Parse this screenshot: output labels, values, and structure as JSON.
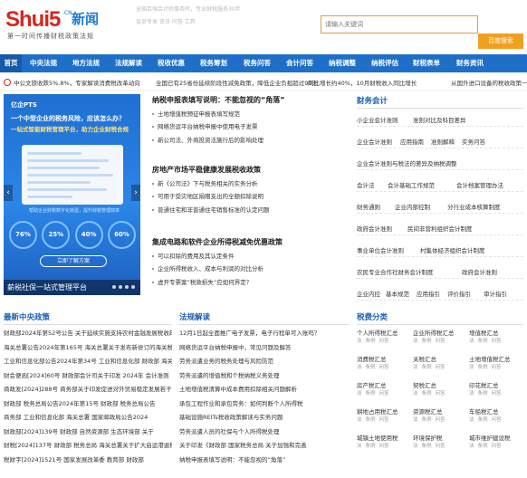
{
  "header": {
    "logo_text": "Shui5",
    "logo_badge": "新闻",
    "logo_dotcn": ".CN",
    "slogan": "第一时间传播财税政策法规",
    "top_ad_lines": [
      "全国百强会计师事务所，专业财税服务30年",
      "会员专享  资讯·问答·工具"
    ],
    "search_placeholder": "请输入关键词",
    "search_button": "百度搜索"
  },
  "nav": {
    "items": [
      "首页",
      "中央法规",
      "地方法规",
      "法规解读",
      "税收优惠",
      "税务筹划",
      "税务问答",
      "会计问答",
      "纳税调整",
      "纳税评估",
      "财税表单",
      "财务资讯"
    ]
  },
  "ticker": {
    "items": [
      "中公文旅收跌5%.8%，专家解读消费税改革动向",
      "全国已有25省份延续阶段性减免政策，降低企业负担超过90天",
      "同比增长约40%，10月财税收入同比增长",
      "从国外进口设备的税收政策一览"
    ]
  },
  "banner": {
    "brand": "亿企PTS",
    "headline": "一个中型企业的税务风险，应该怎么办？",
    "subline": "一站式智能财税管理平台，助力企业财税合规",
    "subtext": "帮助企业财税数字化转型，提升财税管理效率",
    "stats": [
      "76%",
      "25%",
      "40%",
      "60%"
    ],
    "button": "立即了解方案",
    "caption": "薪税社保一站式管理平台"
  },
  "news_blocks": [
    {
      "title": "纳税申报表填写说明：不能忽视的“角落”",
      "items": [
        "土地增值税预征申报表填写规范",
        "网络货运平台纳税申报中使用电子发票",
        "新公司法、外商投资法施行后的影响处理"
      ]
    },
    {
      "title": "房地产市场平稳健康发展税收政策",
      "items": [
        "新《公司法》下与税务相关的实务分析",
        "可用于受灾地区捐赠支出的全额扣除说明",
        "普通住宅和非普通住宅销售标准的认定问题"
      ]
    },
    {
      "title": "集成电路和软件企业所得税减免优惠政策",
      "items": [
        "可以扣除的费用及其认定条件",
        "企业所得税收入、成本与利润的对比分析",
        "虚开专票案“税款损失”应如何界定？"
      ]
    }
  ],
  "finance": {
    "title": "财务会计",
    "rows": [
      [
        "小企业会计准则",
        "准则对比及科目差异"
      ],
      [
        "企业会计准则",
        "应用指南",
        "准则解释",
        "实务问答"
      ],
      [
        "企业会计准则与税法的差异及纳税调整"
      ],
      [
        "会计法",
        "会计基础工作规范",
        "会计档案管理办法"
      ],
      [
        "财务通则",
        "企业内部控制",
        "分行业成本核算制度"
      ],
      [
        "政府会计准则",
        "民间非营利组织会计制度"
      ],
      [
        "事业单位会计准则",
        "村集体经济组织会计制度"
      ],
      [
        "农民专业合作社财务会计制度",
        "政府会计准则"
      ],
      [
        "企业内控",
        "基本规范",
        "应用指引",
        "评价指引",
        "审计指引"
      ]
    ]
  },
  "latest_policy": {
    "title": "最新中央政策",
    "items": [
      "财政部2024年第52号公告 关于延续实施支持农村金融发展税收政策",
      "海关总署公告2024年第165号 海关总署关于发布新修订的海关税则",
      "工业和信息化部公告2024年第34号 工业和信息化部 财政部 海关总署",
      "财会便函[2024]60号 财政部会计司关于印发 2024年 会计准则",
      "商政发[2024]288号 商务部关于印发促进对外贸易稳定发展若干",
      "财政部 税务总局公告2024年第15号 财政部 税务总局公告",
      "商务部 工业和信息化部 海关总署 国家邮政局公告2024",
      "财政部[2024]139号 财政部 自然资源部 生态环境部 关于",
      "财税[2024]137号 财政部 税务总局 海关总署关于扩大启运港退税",
      "税财字[2024]1521号 国家发展改革委 教育部 财政部"
    ]
  },
  "interpretation": {
    "title": "法规解读",
    "items": [
      "12月1日起全面推广电子发票，电子行程单可入账吗？",
      "网络货运平台纳税申报中，常见问题及解答",
      "劳务派遣业务的税务处理与风险防范",
      "劳务派遣的增值税和个税纳税义务处理",
      "土地增值税清算中成本费用扣除相关问题解析",
      "承包工程作业和承包劳务：如何判断个人所得税",
      "基础设施REITs税收政策解读与实务问题",
      "劳务派遣人员的社保与个人所得税处理",
      "关于印发《财政部 国家税务总局 关于加强和完善",
      "纳税申报表填写说明：不能忽视的“角落”"
    ]
  },
  "tax_categories": {
    "title": "税费分类",
    "subs": [
      "法",
      "条例",
      "问答"
    ],
    "names": [
      "个人所得税汇总",
      "企业所得税汇总",
      "增值税汇总",
      "消费税汇总",
      "关税汇总",
      "土地增值税汇总",
      "房产税汇总",
      "契税汇总",
      "印花税汇总",
      "耕地占用税汇总",
      "资源税汇总",
      "车船税汇总",
      "城镇土地使用税",
      "环境保护税",
      "城市维护建设税"
    ]
  },
  "colors": {
    "brand_red": "#d7261d",
    "nav_blue": "#1e6fc8",
    "section_blue": "#1a5fb4",
    "search_orange": "#f0a020"
  }
}
